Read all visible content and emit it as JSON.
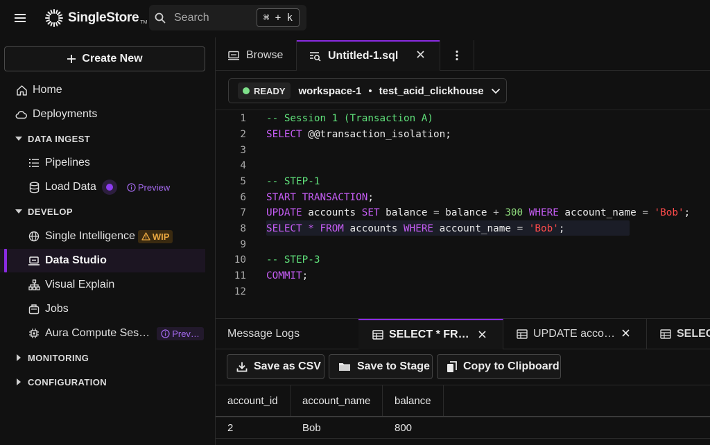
{
  "app": {
    "brand": "SingleStore",
    "brand_tm": "TM",
    "search_placeholder": "Search",
    "search_shortcut": "⌘ + k"
  },
  "sidebar": {
    "create_new": "Create New",
    "home": "Home",
    "deployments": "Deployments",
    "sections": {
      "data_ingest": "DATA INGEST",
      "develop": "DEVELOP",
      "monitoring": "MONITORING",
      "configuration": "CONFIGURATION"
    },
    "pipelines": "Pipelines",
    "load_data": "Load Data",
    "load_data_badge": "Preview",
    "single_intelligence": "Single Intelligence",
    "single_intelligence_badge": "WIP",
    "data_studio": "Data Studio",
    "visual_explain": "Visual Explain",
    "jobs": "Jobs",
    "aura": "Aura Compute Ses…",
    "aura_badge": "Prev…"
  },
  "tabs": {
    "browse": "Browse",
    "sql": "Untitled-1.sql"
  },
  "workspace": {
    "status": "READY",
    "status_color": "#7ee08a",
    "name": "workspace-1",
    "separator": "•",
    "database": "test_acid_clickhouse"
  },
  "editor": {
    "line_numbers": [
      "1",
      "2",
      "3",
      "4",
      "5",
      "6",
      "7",
      "8",
      "9",
      "10",
      "11",
      "12"
    ],
    "lines": {
      "l1": "-- Session 1 (Transaction A)",
      "l2_kw": "SELECT",
      "l2_rest": " @@transaction_isolation;",
      "l5": "-- STEP-1",
      "l6_kw": "START TRANSACTION",
      "l6_rest": ";",
      "l7_kw1": "UPDATE",
      "l7_t1": " accounts ",
      "l7_kw2": "SET",
      "l7_t2": " balance ",
      "l7_op1": "=",
      "l7_t3": " balance ",
      "l7_op2": "+",
      "l7_num": " 300 ",
      "l7_kw3": "WHERE",
      "l7_t4": " account_name ",
      "l7_op3": "=",
      "l7_str": " 'Bob'",
      "l7_end": ";",
      "l8_kw1": "SELECT",
      "l8_op1": " * ",
      "l8_kw2": "FROM",
      "l8_t1": " accounts ",
      "l8_kw3": "WHERE",
      "l8_t2": " account_name ",
      "l8_op2": "=",
      "l8_str": " 'Bob'",
      "l8_end": ";",
      "l10": "-- STEP-3",
      "l11_kw": "COMMIT",
      "l11_rest": ";"
    }
  },
  "results": {
    "tab_logs": "Message Logs",
    "tab_1": "SELECT * FR…",
    "tab_2": "UPDATE acco…",
    "tab_3": "SELEC",
    "btn_csv": "Save as CSV",
    "btn_stage": "Save to Stage",
    "btn_clipboard": "Copy to Clipboard",
    "columns": [
      "account_id",
      "account_name",
      "balance"
    ],
    "rows": [
      [
        "2",
        "Bob",
        "800"
      ]
    ]
  },
  "colors": {
    "accent": "#8a2be2",
    "keyword": "#c65df5",
    "comment": "#5fe07a",
    "string": "#ff4b4b",
    "wip": "#e8a640"
  }
}
